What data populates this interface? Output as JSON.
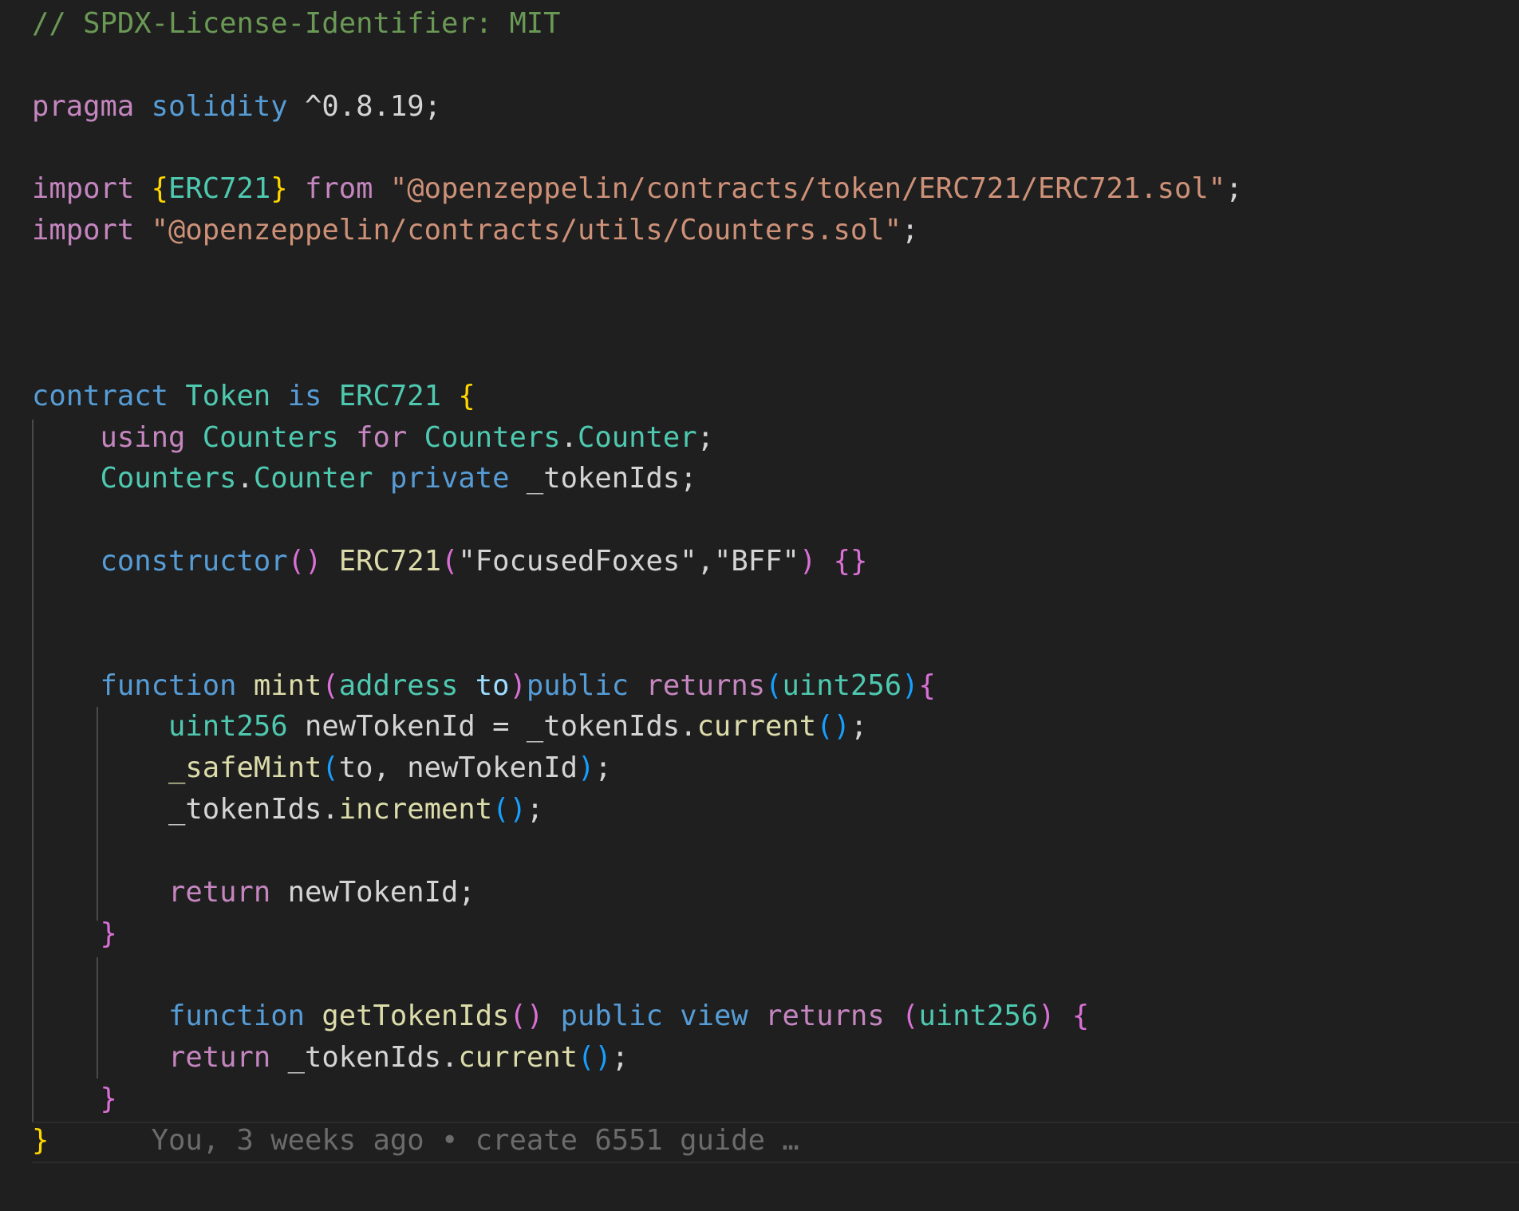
{
  "editor": {
    "language": "solidity",
    "colors": {
      "background": "#1f1f1f",
      "comment": "#6a9955",
      "keyword": "#c586c0",
      "storage": "#569cd6",
      "type": "#4ec9b0",
      "function": "#dcdcaa",
      "string": "#ce9178",
      "variable": "#9cdcfe",
      "plain": "#d4d4d4",
      "bracket1": "#ffd700",
      "bracket2": "#da70d6",
      "bracket3": "#179fff",
      "blame": "#6b6b6b"
    },
    "lines": [
      {
        "tokens": [
          {
            "c": "c-comment",
            "t": "// SPDX-License-Identifier: MIT"
          }
        ]
      },
      {
        "tokens": []
      },
      {
        "tokens": [
          {
            "c": "c-keyword",
            "t": "pragma"
          },
          {
            "c": "c-plain",
            "t": " "
          },
          {
            "c": "c-storage",
            "t": "solidity"
          },
          {
            "c": "c-plain",
            "t": " ^0.8.19;"
          }
        ]
      },
      {
        "tokens": []
      },
      {
        "tokens": [
          {
            "c": "c-keyword",
            "t": "import"
          },
          {
            "c": "c-plain",
            "t": " "
          },
          {
            "c": "c-br1",
            "t": "{"
          },
          {
            "c": "c-type",
            "t": "ERC721"
          },
          {
            "c": "c-br1",
            "t": "}"
          },
          {
            "c": "c-plain",
            "t": " "
          },
          {
            "c": "c-keyword",
            "t": "from"
          },
          {
            "c": "c-plain",
            "t": " "
          },
          {
            "c": "c-string",
            "t": "\"@openzeppelin/contracts/token/ERC721/ERC721.sol\""
          },
          {
            "c": "c-plain",
            "t": ";"
          }
        ]
      },
      {
        "tokens": [
          {
            "c": "c-keyword",
            "t": "import"
          },
          {
            "c": "c-plain",
            "t": " "
          },
          {
            "c": "c-string",
            "t": "\"@openzeppelin/contracts/utils/Counters.sol\""
          },
          {
            "c": "c-plain",
            "t": ";"
          }
        ]
      },
      {
        "tokens": []
      },
      {
        "tokens": []
      },
      {
        "tokens": []
      },
      {
        "tokens": [
          {
            "c": "c-storage",
            "t": "contract"
          },
          {
            "c": "c-plain",
            "t": " "
          },
          {
            "c": "c-type",
            "t": "Token"
          },
          {
            "c": "c-plain",
            "t": " "
          },
          {
            "c": "c-storage",
            "t": "is"
          },
          {
            "c": "c-plain",
            "t": " "
          },
          {
            "c": "c-type",
            "t": "ERC721"
          },
          {
            "c": "c-plain",
            "t": " "
          },
          {
            "c": "c-br1",
            "t": "{"
          }
        ]
      },
      {
        "tokens": [
          {
            "c": "c-plain",
            "t": "    "
          },
          {
            "c": "c-keyword",
            "t": "using"
          },
          {
            "c": "c-plain",
            "t": " "
          },
          {
            "c": "c-type",
            "t": "Counters"
          },
          {
            "c": "c-plain",
            "t": " "
          },
          {
            "c": "c-keyword",
            "t": "for"
          },
          {
            "c": "c-plain",
            "t": " "
          },
          {
            "c": "c-type",
            "t": "Counters"
          },
          {
            "c": "c-plain",
            "t": "."
          },
          {
            "c": "c-type",
            "t": "Counter"
          },
          {
            "c": "c-plain",
            "t": ";"
          }
        ]
      },
      {
        "tokens": [
          {
            "c": "c-plain",
            "t": "    "
          },
          {
            "c": "c-type",
            "t": "Counters"
          },
          {
            "c": "c-plain",
            "t": "."
          },
          {
            "c": "c-type",
            "t": "Counter"
          },
          {
            "c": "c-plain",
            "t": " "
          },
          {
            "c": "c-storage",
            "t": "private"
          },
          {
            "c": "c-plain",
            "t": " _tokenIds;"
          }
        ]
      },
      {
        "tokens": []
      },
      {
        "tokens": [
          {
            "c": "c-plain",
            "t": "    "
          },
          {
            "c": "c-storage",
            "t": "constructor"
          },
          {
            "c": "c-br2",
            "t": "()"
          },
          {
            "c": "c-plain",
            "t": " "
          },
          {
            "c": "c-func",
            "t": "ERC721"
          },
          {
            "c": "c-br2",
            "t": "("
          },
          {
            "c": "c-string-w",
            "t": "\"FocusedFoxes\",\"BFF\""
          },
          {
            "c": "c-br2",
            "t": ")"
          },
          {
            "c": "c-plain",
            "t": " "
          },
          {
            "c": "c-br2",
            "t": "{}"
          }
        ]
      },
      {
        "tokens": []
      },
      {
        "tokens": []
      },
      {
        "tokens": [
          {
            "c": "c-plain",
            "t": "    "
          },
          {
            "c": "c-storage",
            "t": "function"
          },
          {
            "c": "c-plain",
            "t": " "
          },
          {
            "c": "c-func",
            "t": "mint"
          },
          {
            "c": "c-br2",
            "t": "("
          },
          {
            "c": "c-type",
            "t": "address"
          },
          {
            "c": "c-plain",
            "t": " "
          },
          {
            "c": "c-var",
            "t": "to"
          },
          {
            "c": "c-br2",
            "t": ")"
          },
          {
            "c": "c-storage",
            "t": "public"
          },
          {
            "c": "c-plain",
            "t": " "
          },
          {
            "c": "c-keyword",
            "t": "returns"
          },
          {
            "c": "c-br3",
            "t": "("
          },
          {
            "c": "c-type",
            "t": "uint256"
          },
          {
            "c": "c-br3",
            "t": ")"
          },
          {
            "c": "c-br2",
            "t": "{"
          }
        ]
      },
      {
        "tokens": [
          {
            "c": "c-plain",
            "t": "        "
          },
          {
            "c": "c-type",
            "t": "uint256"
          },
          {
            "c": "c-plain",
            "t": " newTokenId = _tokenIds."
          },
          {
            "c": "c-func",
            "t": "current"
          },
          {
            "c": "c-br3",
            "t": "()"
          },
          {
            "c": "c-plain",
            "t": ";"
          }
        ]
      },
      {
        "tokens": [
          {
            "c": "c-plain",
            "t": "        "
          },
          {
            "c": "c-func",
            "t": "_safeMint"
          },
          {
            "c": "c-br3",
            "t": "("
          },
          {
            "c": "c-plain",
            "t": "to, newTokenId"
          },
          {
            "c": "c-br3",
            "t": ")"
          },
          {
            "c": "c-plain",
            "t": ";"
          }
        ]
      },
      {
        "tokens": [
          {
            "c": "c-plain",
            "t": "        _tokenIds."
          },
          {
            "c": "c-func",
            "t": "increment"
          },
          {
            "c": "c-br3",
            "t": "()"
          },
          {
            "c": "c-plain",
            "t": ";"
          }
        ]
      },
      {
        "tokens": []
      },
      {
        "tokens": [
          {
            "c": "c-plain",
            "t": "        "
          },
          {
            "c": "c-keyword",
            "t": "return"
          },
          {
            "c": "c-plain",
            "t": " newTokenId;"
          }
        ]
      },
      {
        "tokens": [
          {
            "c": "c-plain",
            "t": "    "
          },
          {
            "c": "c-br2",
            "t": "}"
          }
        ]
      },
      {
        "tokens": []
      },
      {
        "tokens": [
          {
            "c": "c-plain",
            "t": "        "
          },
          {
            "c": "c-storage",
            "t": "function"
          },
          {
            "c": "c-plain",
            "t": " "
          },
          {
            "c": "c-func",
            "t": "getTokenIds"
          },
          {
            "c": "c-br2",
            "t": "()"
          },
          {
            "c": "c-plain",
            "t": " "
          },
          {
            "c": "c-storage",
            "t": "public"
          },
          {
            "c": "c-plain",
            "t": " "
          },
          {
            "c": "c-storage",
            "t": "view"
          },
          {
            "c": "c-plain",
            "t": " "
          },
          {
            "c": "c-keyword",
            "t": "returns"
          },
          {
            "c": "c-plain",
            "t": " "
          },
          {
            "c": "c-br2",
            "t": "("
          },
          {
            "c": "c-type",
            "t": "uint256"
          },
          {
            "c": "c-br2",
            "t": ")"
          },
          {
            "c": "c-plain",
            "t": " "
          },
          {
            "c": "c-br2",
            "t": "{"
          }
        ]
      },
      {
        "tokens": [
          {
            "c": "c-plain",
            "t": "        "
          },
          {
            "c": "c-keyword",
            "t": "return"
          },
          {
            "c": "c-plain",
            "t": " _tokenIds."
          },
          {
            "c": "c-func",
            "t": "current"
          },
          {
            "c": "c-br3",
            "t": "()"
          },
          {
            "c": "c-plain",
            "t": ";"
          }
        ]
      },
      {
        "tokens": [
          {
            "c": "c-plain",
            "t": "    "
          },
          {
            "c": "c-br2",
            "t": "}"
          }
        ]
      },
      {
        "tokens": [
          {
            "c": "c-br1",
            "t": "}"
          }
        ]
      }
    ],
    "blame": "You, 3 weeks ago • create 6551 guide …"
  }
}
